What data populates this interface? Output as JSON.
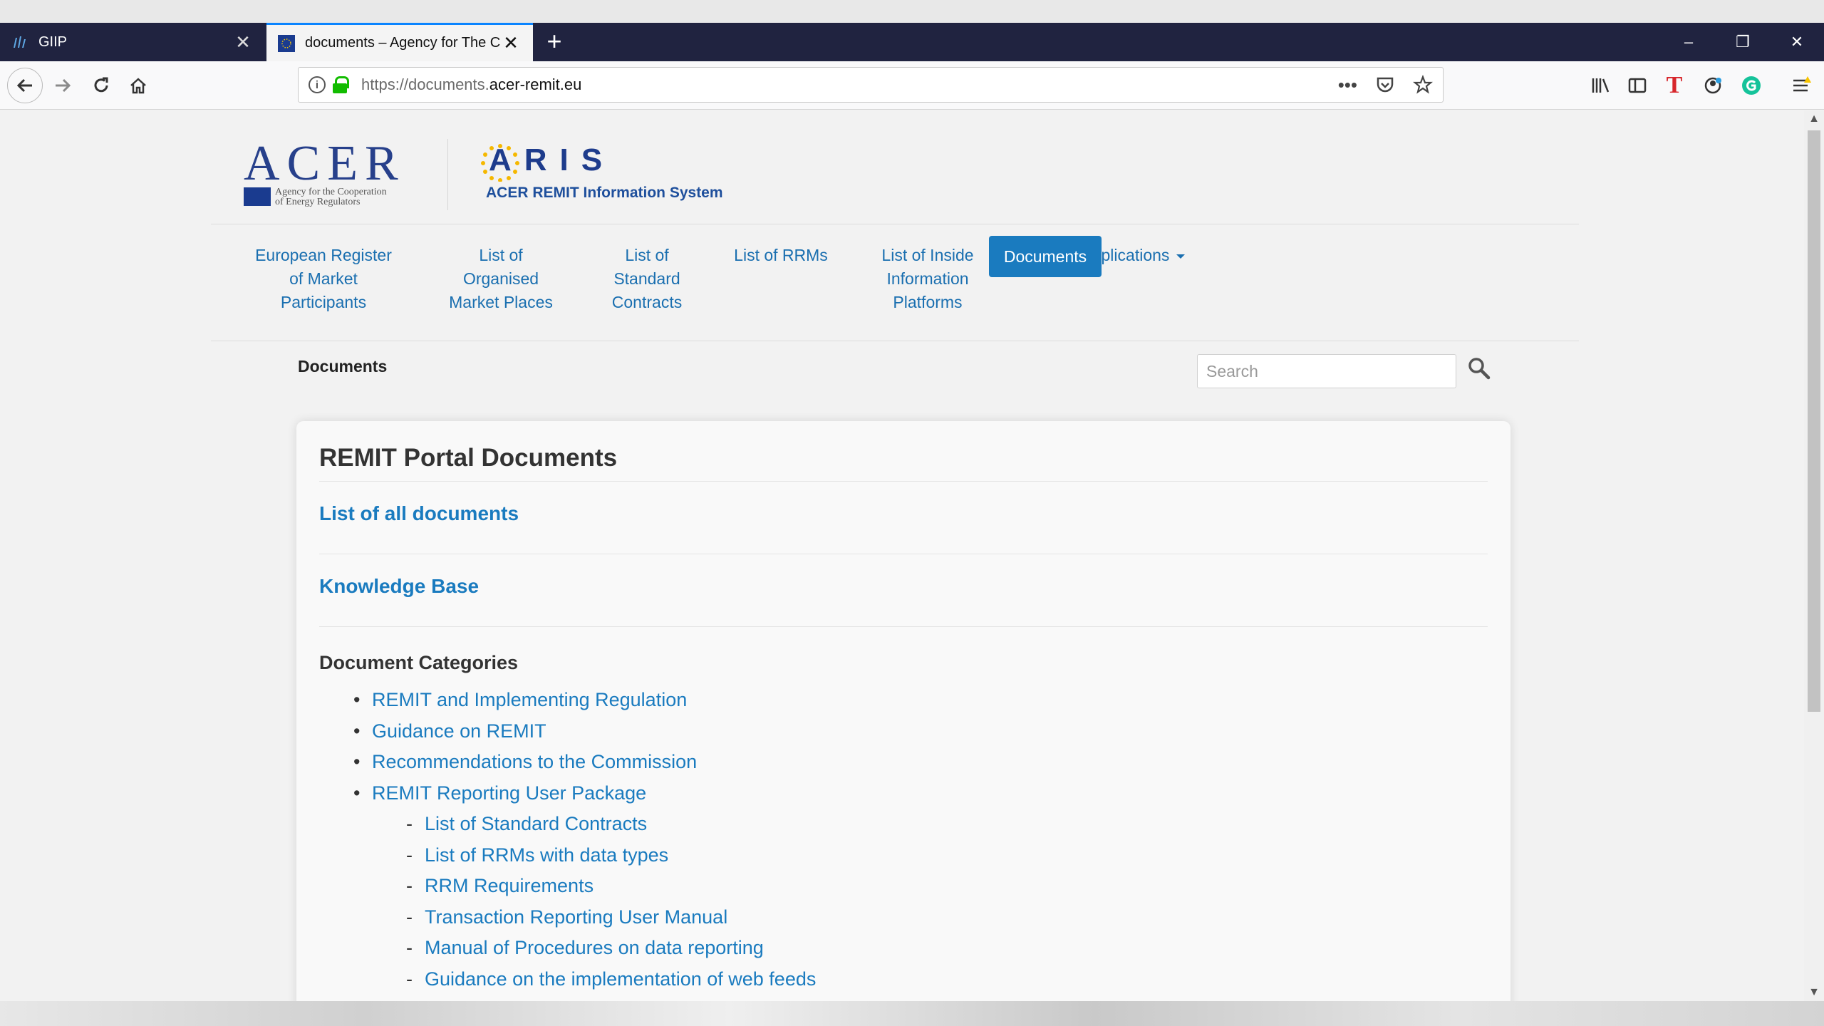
{
  "browser": {
    "tabs": [
      {
        "title": "GIIP",
        "active": false
      },
      {
        "title": "documents – Agency for The Co",
        "active": true
      }
    ],
    "new_tab_symbol": "+",
    "url_scheme": "https://documents.",
    "url_host": "acer-remit.eu",
    "window_buttons": [
      "–",
      "❐",
      "✕"
    ]
  },
  "site": {
    "acer_word": "ACER",
    "acer_subtitle_1": "Agency for the Cooperation",
    "acer_subtitle_2": "of Energy Regulators",
    "aris_word": "ARIS",
    "aris_subtitle": "ACER REMIT Information System"
  },
  "menu": {
    "items": [
      {
        "label": "European Register of Market Participants"
      },
      {
        "label": "List of Organised Market Places"
      },
      {
        "label": "List of Standard Contracts"
      },
      {
        "label": "List of RRMs"
      },
      {
        "label": "List of Inside Information Platforms"
      },
      {
        "label": "ARIS Applications"
      }
    ],
    "active_label": "Documents"
  },
  "breadcrumb": "Documents",
  "search": {
    "placeholder": "Search"
  },
  "card": {
    "title": "REMIT Portal Documents",
    "link_all": "List of all documents",
    "link_kb": "Knowledge Base",
    "categories_title": "Document Categories",
    "categories": [
      "REMIT and Implementing Regulation",
      "Guidance on REMIT",
      "Recommendations to the Commission",
      "REMIT Reporting User Package"
    ],
    "subcategories": [
      "List of Standard Contracts",
      "List of RRMs with data types",
      "RRM Requirements",
      "Transaction Reporting User Manual",
      "Manual of Procedures on data reporting",
      "Guidance on the implementation of web feeds"
    ]
  },
  "colors": {
    "link": "#1a7bbf",
    "active_menu_bg": "#1a7bbf",
    "tabbar_bg": "#202340",
    "acer_blue": "#27408b"
  }
}
